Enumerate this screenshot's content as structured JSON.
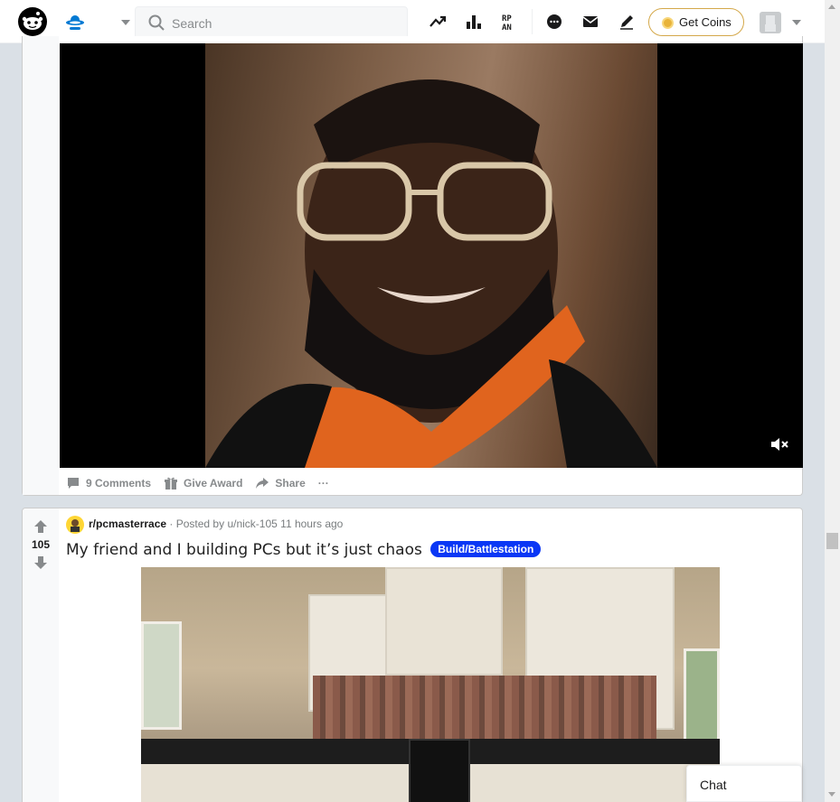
{
  "header": {
    "search_placeholder": "Search",
    "get_coins_label": "Get Coins",
    "icons": [
      "reddit-logo",
      "home-icon",
      "popular-icon",
      "all-icon",
      "rpan-icon",
      "chat-icon",
      "inbox-icon",
      "create-post-icon",
      "coin-icon",
      "avatar"
    ]
  },
  "post1": {
    "comments_label": "9 Comments",
    "award_label": "Give Award",
    "share_label": "Share",
    "more_label": "···"
  },
  "post2": {
    "votes": "105",
    "subreddit": "r/pcmasterrace",
    "posted_by_prefix": "· Posted by",
    "author": "u/nick-105",
    "time": "11 hours ago",
    "title": "My friend and I building PCs but it’s just chaos",
    "flair": "Build/Battlestation"
  },
  "chat": {
    "label": "Chat"
  },
  "colors": {
    "accent": "#0079d3",
    "flair": "#0a37f5",
    "upvote": "#878a8c",
    "background": "#dae0e6"
  }
}
